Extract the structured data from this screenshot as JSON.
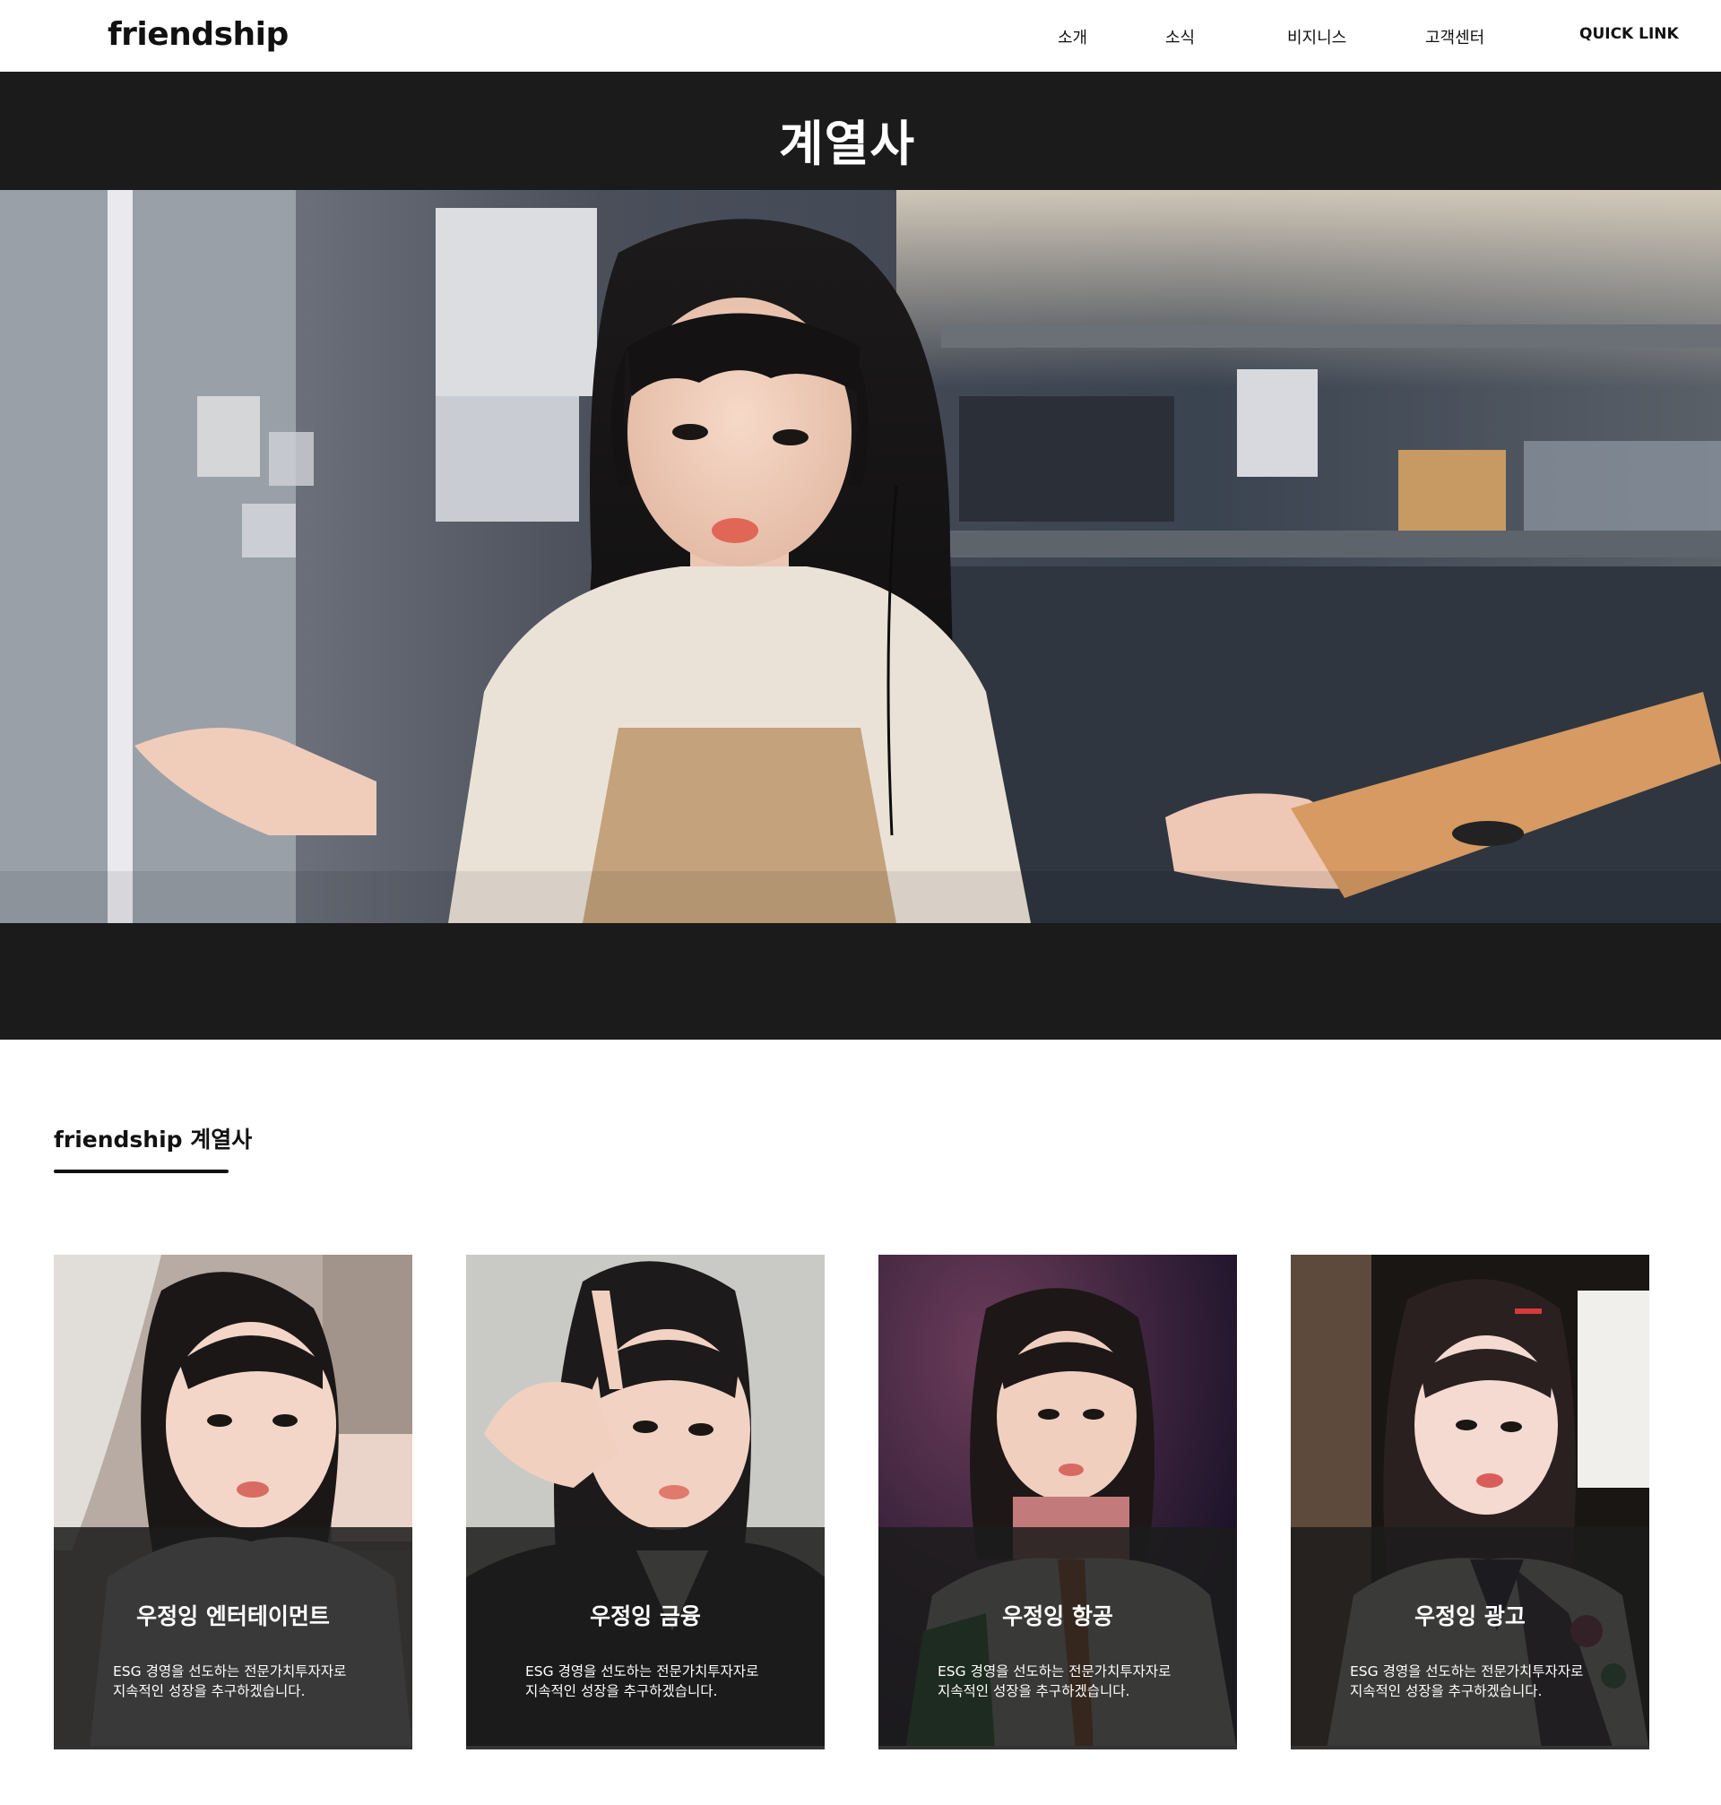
{
  "header": {
    "logo": "friendship",
    "nav": [
      "소개",
      "소식",
      "비지니스",
      "고객센터",
      "QUICK LINK"
    ]
  },
  "hero": {
    "title": "계열사"
  },
  "section": {
    "title": "friendship 계열사"
  },
  "cards": [
    {
      "title": "우정잉 엔터테이먼트",
      "desc_line1": "ESG 경영을 선도하는 전문가치투자자로",
      "desc_line2": "지속적인 성장을 추구하겠습니다."
    },
    {
      "title": "우정잉 금융",
      "desc_line1": "ESG 경영을 선도하는 전문가치투자자로",
      "desc_line2": "지속적인 성장을 추구하겠습니다."
    },
    {
      "title": "우정잉 항공",
      "desc_line1": "ESG 경영을 선도하는 전문가치투자자로",
      "desc_line2": "지속적인 성장을 추구하겠습니다."
    },
    {
      "title": "우정잉 광고",
      "desc_line1": "ESG 경영을 선도하는 전문가치투자자로",
      "desc_line2": "지속적인 성장을 추구하겠습니다."
    }
  ],
  "colors": {
    "hero_background": "#1b1b1b",
    "card_overlay": "#1c1c1c",
    "text_dark": "#111111",
    "text_light": "#ffffff"
  }
}
